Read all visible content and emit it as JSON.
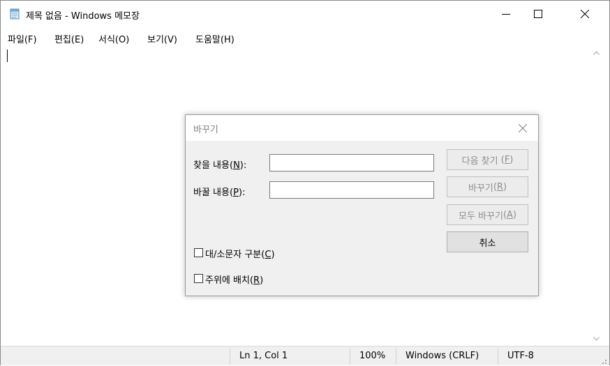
{
  "window": {
    "title": "제목 없음 - Windows 메모장",
    "minimize_symbol": "—",
    "maximize_symbol": "☐",
    "close_symbol": "✕"
  },
  "menu": {
    "items": [
      "파일(F)",
      "편집(E)",
      "서식(O)",
      "보기(V)",
      "도움말(H)"
    ]
  },
  "editor": {
    "content": ""
  },
  "statusbar": {
    "position": "Ln 1, Col 1",
    "zoom": "100%",
    "line_ending": "Windows (CRLF)",
    "encoding": "UTF-8"
  },
  "dialog": {
    "title": "바꾸기",
    "close_symbol": "✕",
    "find_label": "찾을 내용",
    "find_key": "N",
    "replace_label": "바꿀 내용",
    "replace_key": "P",
    "find_value": "",
    "replace_value": "",
    "find_next_label": "다음 찾기",
    "find_next_key": "F",
    "replace_label_btn": "바꾸기",
    "replace_key_btn": "R",
    "replace_all_label": "모두 바꾸기",
    "replace_all_key": "A",
    "cancel_label": "취소",
    "match_case_label": "대/소문자 구분",
    "match_case_key": "C",
    "match_case_checked": false,
    "wrap_label": "주위에 배치",
    "wrap_key": "R",
    "wrap_checked": false
  }
}
